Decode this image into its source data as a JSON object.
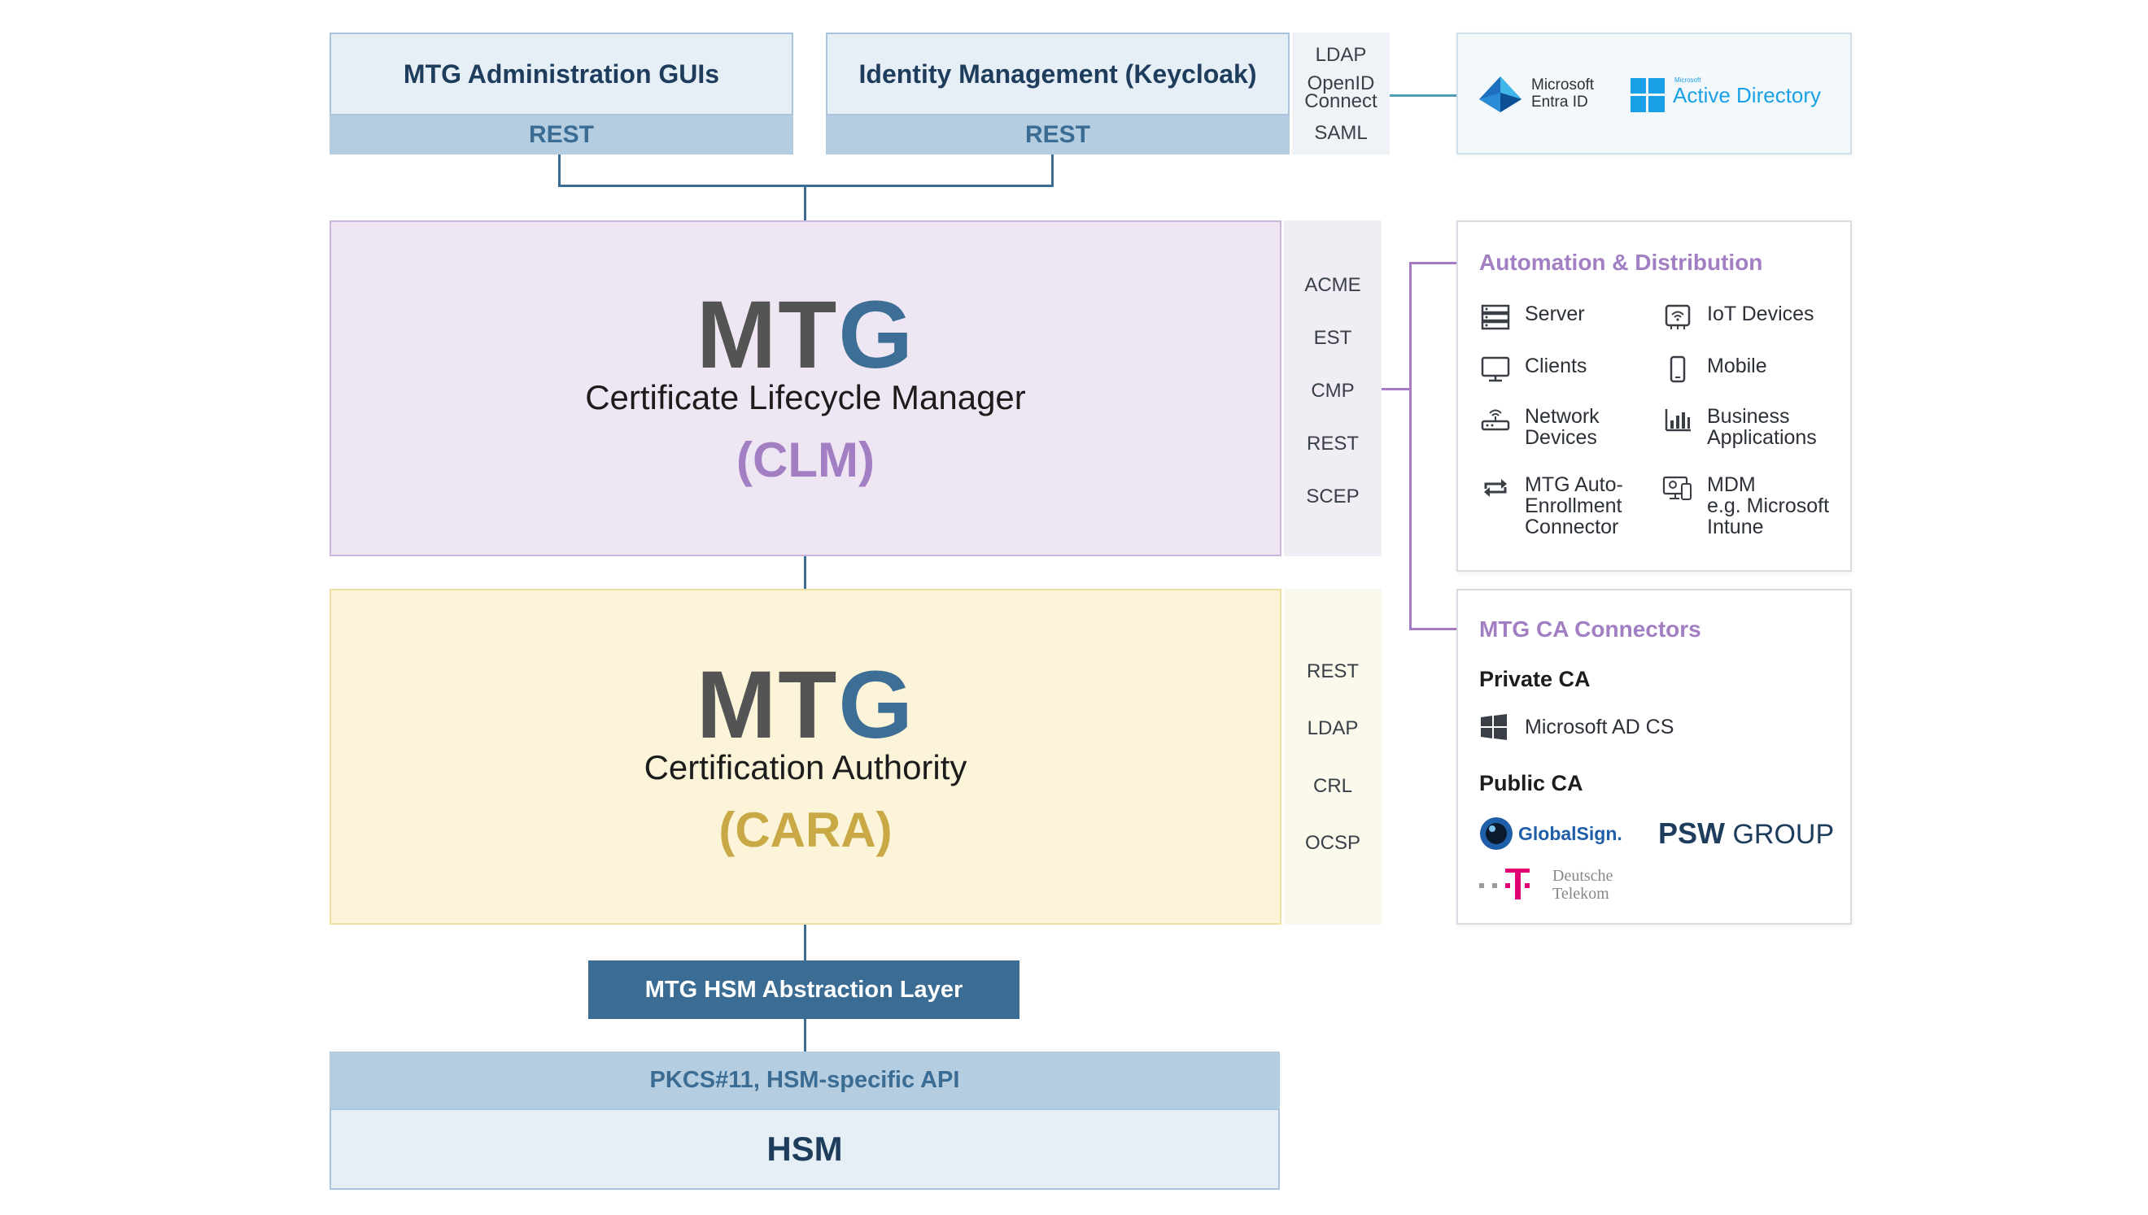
{
  "top": {
    "admin_gui": {
      "title": "MTG Administration GUIs",
      "interface": "REST"
    },
    "identity": {
      "title": "Identity Management (Keycloak)",
      "interface": "REST"
    },
    "identity_protocols": [
      "LDAP",
      "OpenID\nConnect",
      "SAML"
    ],
    "directory": {
      "entra_label": "Microsoft\nEntra ID",
      "ad_small": "Microsoft",
      "ad_label": "Active Directory"
    }
  },
  "clm": {
    "brand_mt": "MT",
    "brand_g": "G",
    "subtitle": "Certificate Lifecycle Manager",
    "abbr": "(CLM)",
    "protocols": [
      "ACME",
      "EST",
      "CMP",
      "REST",
      "SCEP"
    ]
  },
  "cara": {
    "brand_mt": "MT",
    "brand_g": "G",
    "subtitle": "Certification Authority",
    "abbr": "(CARA)",
    "protocols": [
      "REST",
      "LDAP",
      "CRL",
      "OCSP"
    ]
  },
  "hsm": {
    "abstraction": "MTG HSM Abstraction Layer",
    "api": "PKCS#11, HSM-specific API",
    "title": "HSM"
  },
  "automation": {
    "title": "Automation & Distribution",
    "items": [
      {
        "icon": "server-icon",
        "label": "Server"
      },
      {
        "icon": "iot-devices-icon",
        "label": "IoT Devices"
      },
      {
        "icon": "clients-monitor-icon",
        "label": "Clients"
      },
      {
        "icon": "mobile-phone-icon",
        "label": "Mobile"
      },
      {
        "icon": "network-router-icon",
        "label": "Network\nDevices"
      },
      {
        "icon": "bar-chart-icon",
        "label": "Business\nApplications"
      },
      {
        "icon": "sync-arrows-icon",
        "label": "MTG Auto-\nEnrollment\nConnector"
      },
      {
        "icon": "mdm-devices-icon",
        "label": "MDM\ne.g. Microsoft\nIntune"
      }
    ]
  },
  "ca_connectors": {
    "title": "MTG CA Connectors",
    "private_heading": "Private CA",
    "private_item": "Microsoft AD CS",
    "public_heading": "Public CA",
    "globalsign": "GlobalSign.",
    "psw_bold": "PSW",
    "psw_rest": " GROUP",
    "telekom": "Deutsche\nTelekom"
  },
  "colors": {
    "accent_blue": "#3b6c94",
    "clm_purple": "#a27ec2",
    "cara_gold": "#c9a945",
    "clm_fill": "#efe6f3",
    "cara_fill": "#fbf4d8"
  }
}
